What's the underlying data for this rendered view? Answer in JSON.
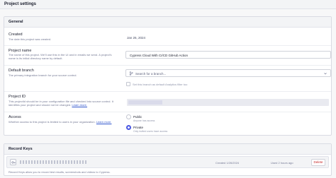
{
  "page": {
    "title": "Project settings"
  },
  "general": {
    "header": "General",
    "created": {
      "label": "Created",
      "description": "The date this project was created.",
      "value": "Jan 26, 2024"
    },
    "project_name": {
      "label": "Project name",
      "description": "The name of this project. We'll use this in the UI and in emails we send. A project's name is its initial directory name by default.",
      "value": "Cypress Cloud With CI/CD GitHub Action"
    },
    "default_branch": {
      "label": "Default branch",
      "description": "The primary integration branch for your source control.",
      "placeholder": "Search for a branch...",
      "checkbox_label": "Set this branch as default Analytics filter too"
    },
    "project_id": {
      "label": "Project ID",
      "description_a": "This projectId should be in your configuration file and checked into source control. It identifies your project and should not be changed.",
      "learn_more": "Learn more."
    },
    "access": {
      "label": "Access",
      "description_a": "Whether access to this project is limited to users in your organization.",
      "learn_more": "Learn more.",
      "options": [
        {
          "label": "Public",
          "description": "Anyone has access"
        },
        {
          "label": "Private",
          "description": "Only invited users have access"
        }
      ],
      "selected": "Private"
    }
  },
  "record_keys": {
    "header": "Record Keys",
    "rows": [
      {
        "created": "Created 1/26/2024",
        "used": "Used 2 hours ago",
        "delete_label": "Delete"
      }
    ],
    "description": "Record Keys allow you to record test results, screenshots and videos to Cypress."
  },
  "colors": {
    "accent": "#4956e3",
    "link": "#2e54cc",
    "danger": "#c62828"
  },
  "icons": [
    "branch-icon",
    "chevron-down-icon",
    "key-icon"
  ]
}
